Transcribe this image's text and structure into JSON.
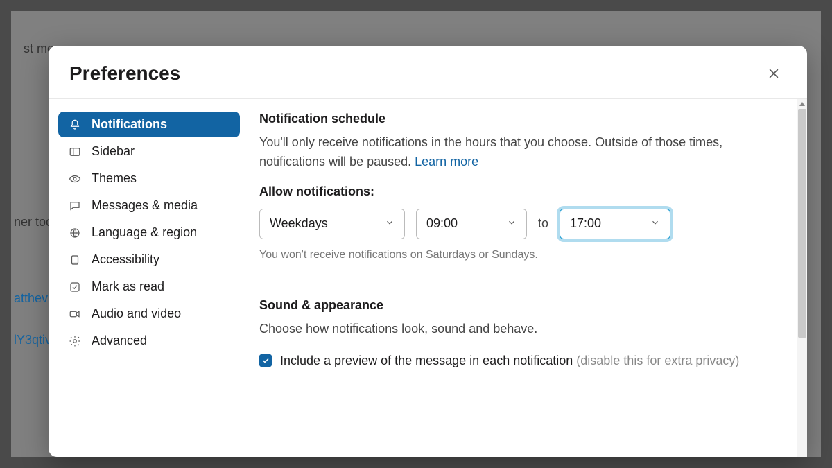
{
  "background": {
    "frag1": "st me.",
    "frag2": "ner too",
    "frag3": "atthev",
    "frag4": "lY3qtiv"
  },
  "modal": {
    "title": "Preferences"
  },
  "sidebar": {
    "items": [
      {
        "label": "Notifications",
        "icon": "bell-icon",
        "active": true
      },
      {
        "label": "Sidebar",
        "icon": "sidebar-icon",
        "active": false
      },
      {
        "label": "Themes",
        "icon": "eye-icon",
        "active": false
      },
      {
        "label": "Messages & media",
        "icon": "chat-icon",
        "active": false
      },
      {
        "label": "Language & region",
        "icon": "globe-icon",
        "active": false
      },
      {
        "label": "Accessibility",
        "icon": "accessibility-icon",
        "active": false
      },
      {
        "label": "Mark as read",
        "icon": "check-square-icon",
        "active": false
      },
      {
        "label": "Audio and video",
        "icon": "video-icon",
        "active": false
      },
      {
        "label": "Advanced",
        "icon": "gear-icon",
        "active": false
      }
    ]
  },
  "content": {
    "schedule": {
      "title": "Notification schedule",
      "desc_pre": "You'll only receive notifications in the hours that you choose. Outside of those times, notifications will be paused. ",
      "learn_more": "Learn more",
      "allow_label": "Allow notifications:",
      "days_value": "Weekdays",
      "start_value": "09:00",
      "to": "to",
      "end_value": "17:00",
      "hint": "You won't receive notifications on Saturdays or Sundays."
    },
    "sound": {
      "title": "Sound & appearance",
      "desc": "Choose how notifications look, sound and behave.",
      "preview_label": "Include a preview of the message in each notification ",
      "preview_hint": "(disable this for extra privacy)",
      "preview_checked": true
    }
  }
}
